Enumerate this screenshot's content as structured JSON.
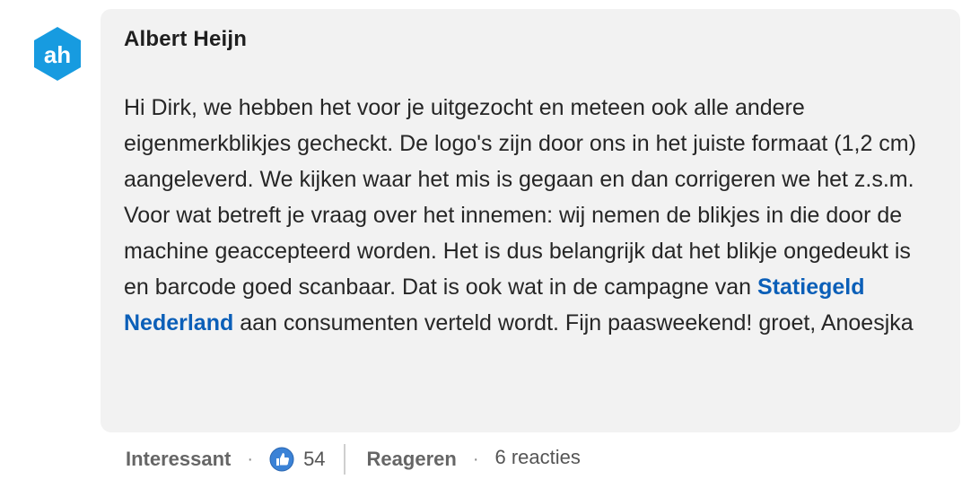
{
  "comment": {
    "author": "Albert Heijn",
    "message_before_link": "Hi Dirk, we hebben het voor je uitgezocht en meteen ook alle andere eigenmerkblikjes gecheckt. De logo's zijn door ons in het juiste formaat (1,2 cm) aangeleverd. We kijken waar het mis is gegaan en dan corrigeren we het z.s.m. Voor wat betreft je vraag over het innemen: wij nemen de blikjes in die door de machine geaccepteerd worden. Het is dus belangrijk dat het blikje ongedeukt is en barcode goed scanbaar. Dat is ook wat in de campagne van ",
    "link_text": "Statiegeld Nederland",
    "message_after_link": " aan consumenten verteld wordt. Fijn paasweekend! groet, Anoesjka"
  },
  "actions": {
    "interessant_label": "Interessant",
    "separator": "·",
    "like_count": "54",
    "reply_label": "Reageren",
    "reactions_count_label": "6 reacties"
  },
  "colors": {
    "bubble_bg": "#f2f2f2",
    "link": "#0b5fb8",
    "brand_blue": "#179be0",
    "like_blue": "#3b82d6"
  },
  "icons": {
    "avatar": "albert-heijn-logo",
    "like": "thumbs-up-icon"
  }
}
